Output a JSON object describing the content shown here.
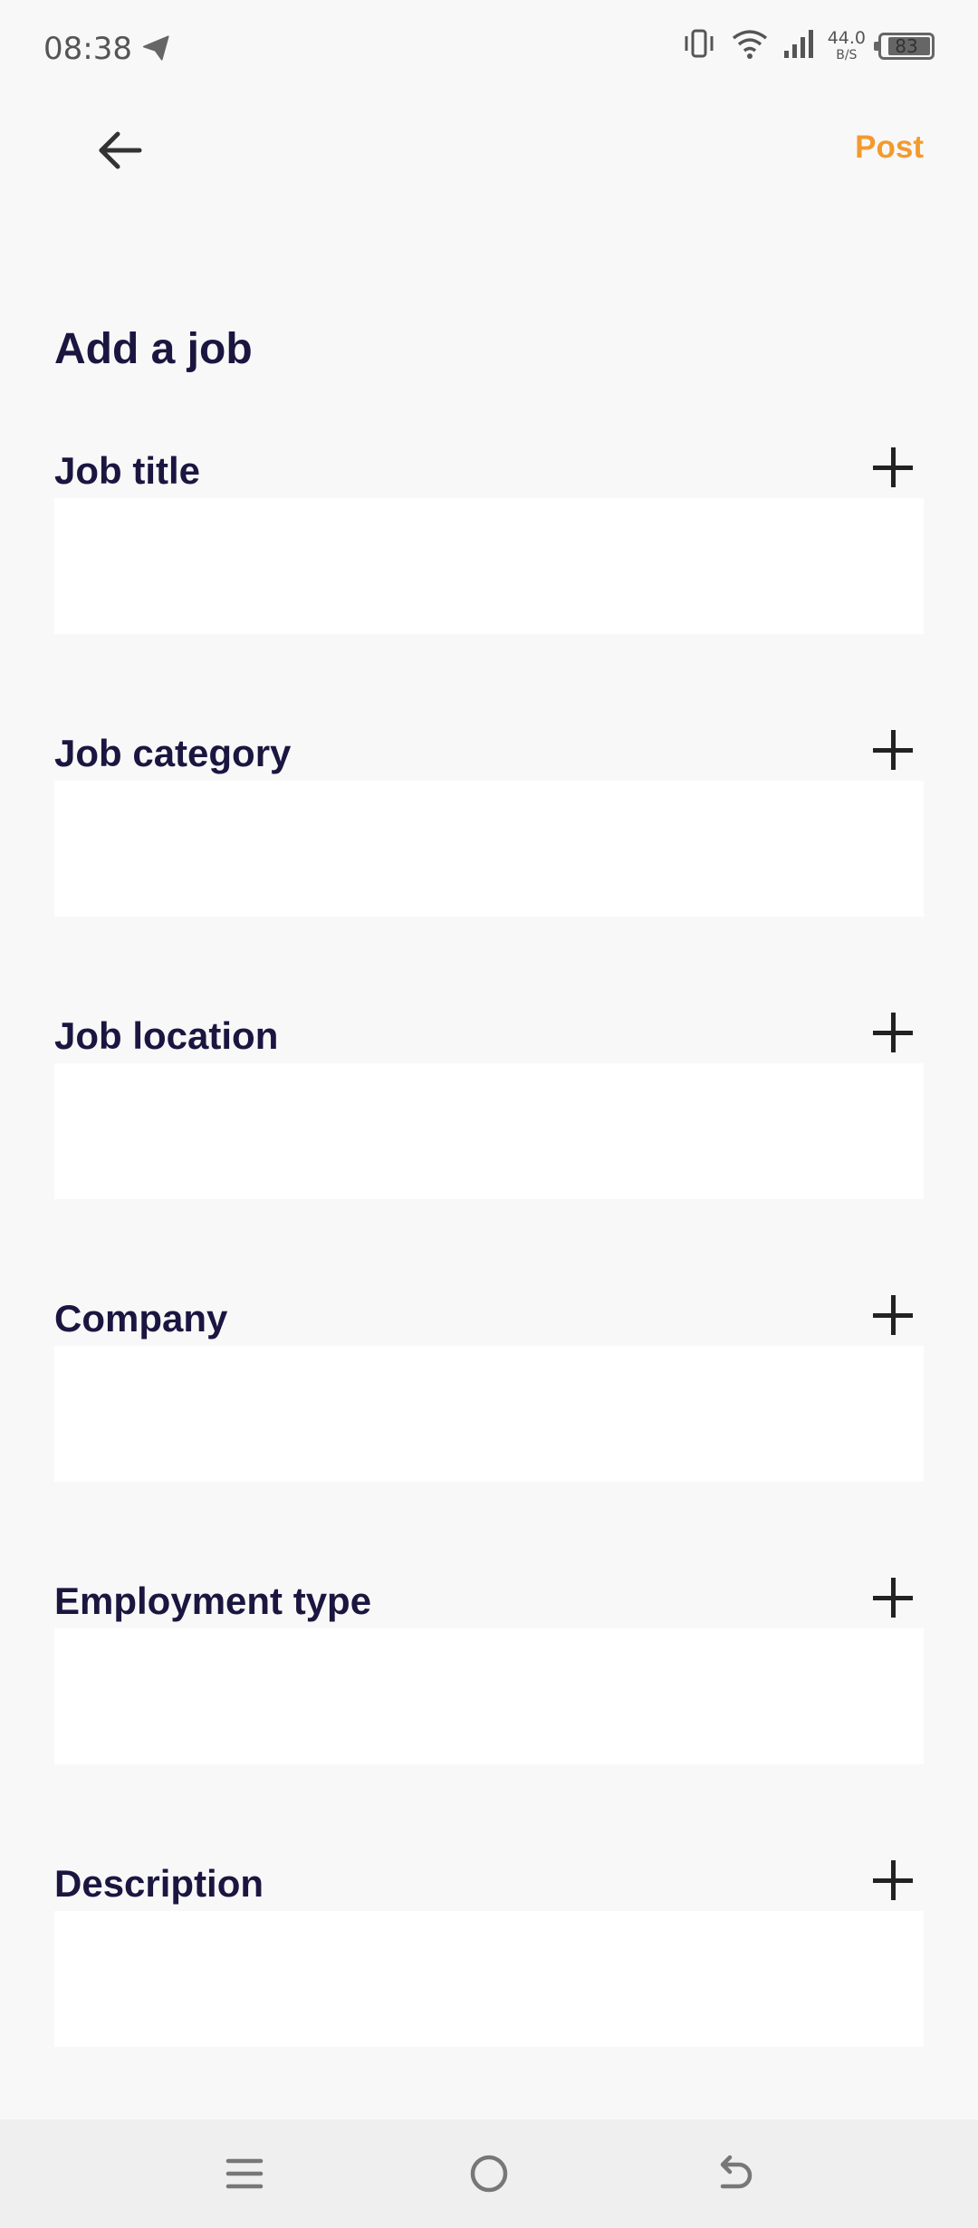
{
  "status_bar": {
    "time": "08:38",
    "net_speed_value": "44.0",
    "net_speed_unit": "B/S",
    "battery": "83"
  },
  "app_bar": {
    "back_icon": "arrow-left-icon",
    "post_label": "Post",
    "post_color": "#f39a2e"
  },
  "page": {
    "title": "Add a job"
  },
  "fields": [
    {
      "label": "Job title",
      "value": ""
    },
    {
      "label": "Job category",
      "value": ""
    },
    {
      "label": "Job location",
      "value": ""
    },
    {
      "label": "Company",
      "value": ""
    },
    {
      "label": "Employment type",
      "value": ""
    },
    {
      "label": "Description",
      "value": ""
    }
  ],
  "nav": {
    "menu_icon": "menu-icon",
    "home_icon": "home-circle-icon",
    "back_icon": "back-return-icon"
  }
}
